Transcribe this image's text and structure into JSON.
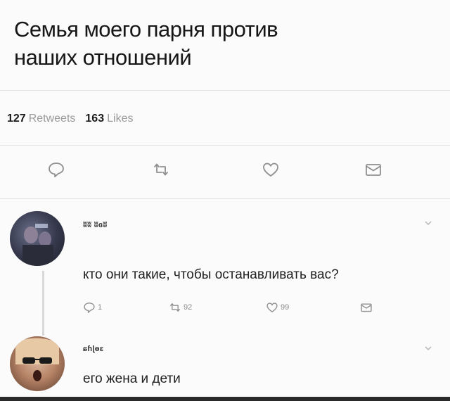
{
  "tweet": {
    "line1": "Семья моего парня против",
    "line2": "наших отношений",
    "retweets_count": "127",
    "retweets_label": "Retweets",
    "likes_count": "163",
    "likes_label": "Likes"
  },
  "actions": [
    "reply-icon",
    "retweet-icon",
    "like-icon",
    "message-icon"
  ],
  "replies": [
    {
      "username": "ʬʬ ʬɞʬ",
      "text": "кто они такие, чтобы останавливать вас?",
      "reply_count": "1",
      "retweet_count": "92",
      "like_count": "99"
    },
    {
      "username": "ɕɦɭɵɛ",
      "text": "его жена и дети"
    }
  ],
  "colors": {
    "icon": "#8f8f8f",
    "text": "#161616",
    "muted": "#9a9a9a"
  }
}
